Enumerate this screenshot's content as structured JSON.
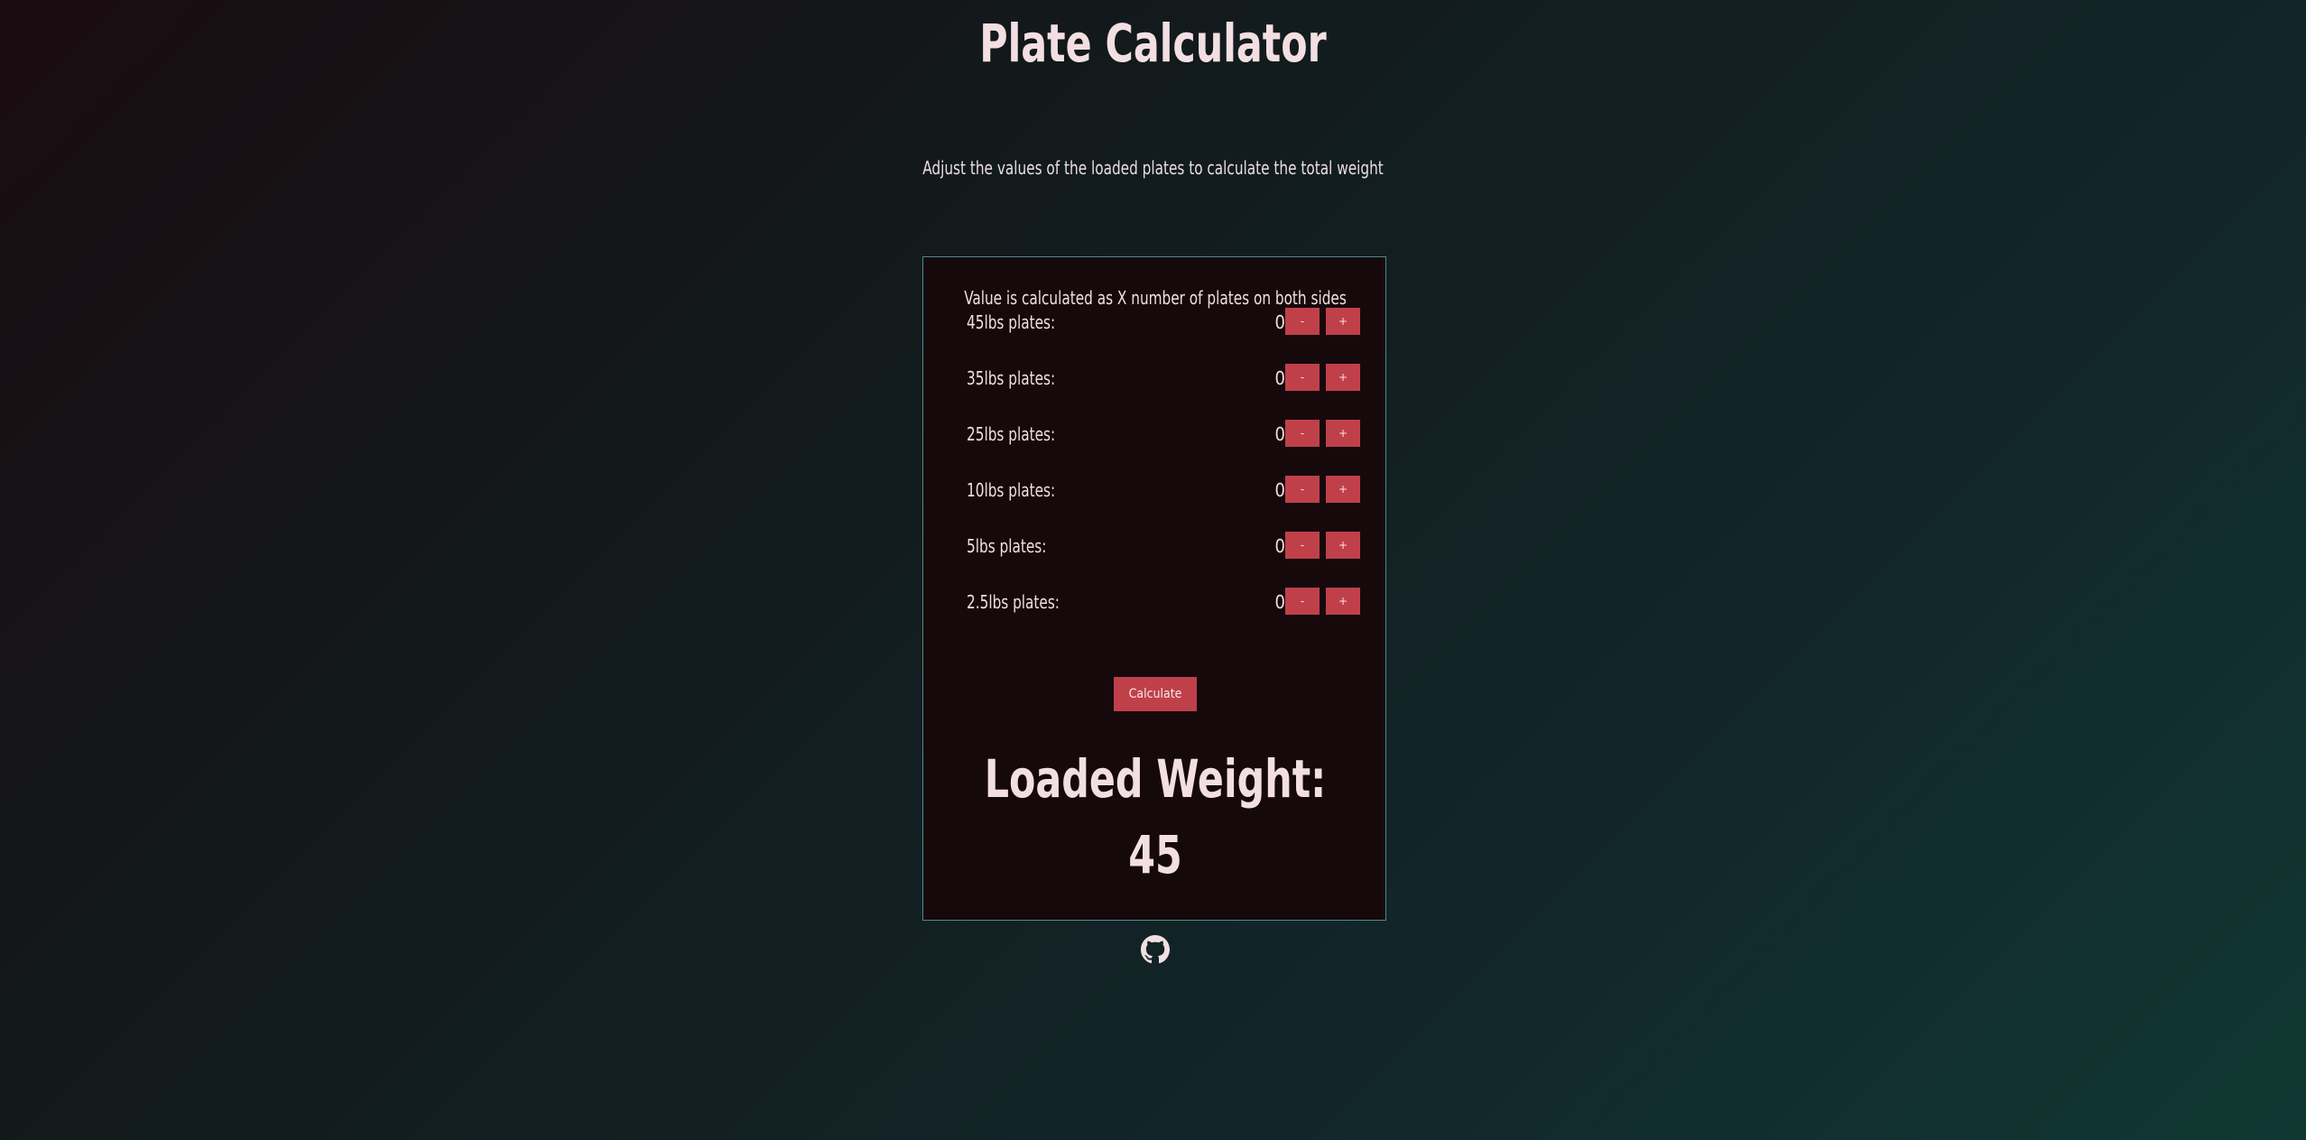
{
  "header": {
    "title": "Plate Calculator",
    "subtitle": "Adjust the values of the loaded plates to calculate the total weight"
  },
  "calculator": {
    "note": "Value is calculated as X number of plates on both sides",
    "minus_label": "-",
    "plus_label": "+",
    "plates": [
      {
        "label": "45lbs plates:",
        "count": "0"
      },
      {
        "label": "35lbs plates:",
        "count": "0"
      },
      {
        "label": "25lbs plates:",
        "count": "0"
      },
      {
        "label": "10lbs plates:",
        "count": "0"
      },
      {
        "label": "5lbs plates:",
        "count": "0"
      },
      {
        "label": "2.5lbs plates:",
        "count": "0"
      }
    ],
    "calculate_label": "Calculate",
    "result_label": "Loaded Weight:",
    "result_value": "45"
  },
  "footer": {
    "icon": "github-icon"
  },
  "colors": {
    "accent": "#c0404a",
    "card_background": "#16090c",
    "card_border": "#4f8a8f",
    "text": "#f1dfe2"
  }
}
